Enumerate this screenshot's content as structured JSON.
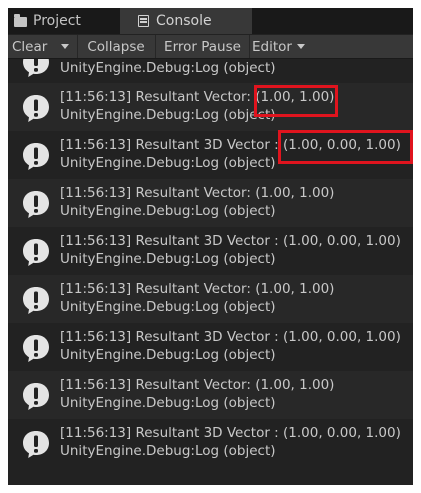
{
  "tabs": [
    {
      "label": "Project",
      "icon": "folder-icon"
    },
    {
      "label": "Console",
      "icon": "console-icon",
      "active": true
    }
  ],
  "toolbar": {
    "clear_label": "Clear",
    "collapse_label": "Collapse",
    "error_pause_label": "Error Pause",
    "editor_label": "Editor"
  },
  "partial_entry": {
    "source": "UnityEngine.Debug:Log (object)"
  },
  "entries": [
    {
      "message": "[11:56:13] Resultant Vector: (1.00, 1.00)",
      "source": "UnityEngine.Debug:Log (object)"
    },
    {
      "message": "[11:56:13] Resultant 3D Vector : (1.00, 0.00, 1.00)",
      "source": "UnityEngine.Debug:Log (object)"
    },
    {
      "message": "[11:56:13] Resultant Vector: (1.00, 1.00)",
      "source": "UnityEngine.Debug:Log (object)"
    },
    {
      "message": "[11:56:13] Resultant 3D Vector : (1.00, 0.00, 1.00)",
      "source": "UnityEngine.Debug:Log (object)"
    },
    {
      "message": "[11:56:13] Resultant Vector: (1.00, 1.00)",
      "source": "UnityEngine.Debug:Log (object)"
    },
    {
      "message": "[11:56:13] Resultant 3D Vector : (1.00, 0.00, 1.00)",
      "source": "UnityEngine.Debug:Log (object)"
    },
    {
      "message": "[11:56:13] Resultant Vector: (1.00, 1.00)",
      "source": "UnityEngine.Debug:Log (object)"
    },
    {
      "message": "[11:56:13] Resultant 3D Vector : (1.00, 0.00, 1.00)",
      "source": "UnityEngine.Debug:Log (object)"
    }
  ],
  "colors": {
    "panel_bg": "#222222",
    "row_alt_bg": "#282828",
    "toolbar_bg": "#383838",
    "text": "#c8c8c8",
    "highlight": "#e0141e"
  }
}
